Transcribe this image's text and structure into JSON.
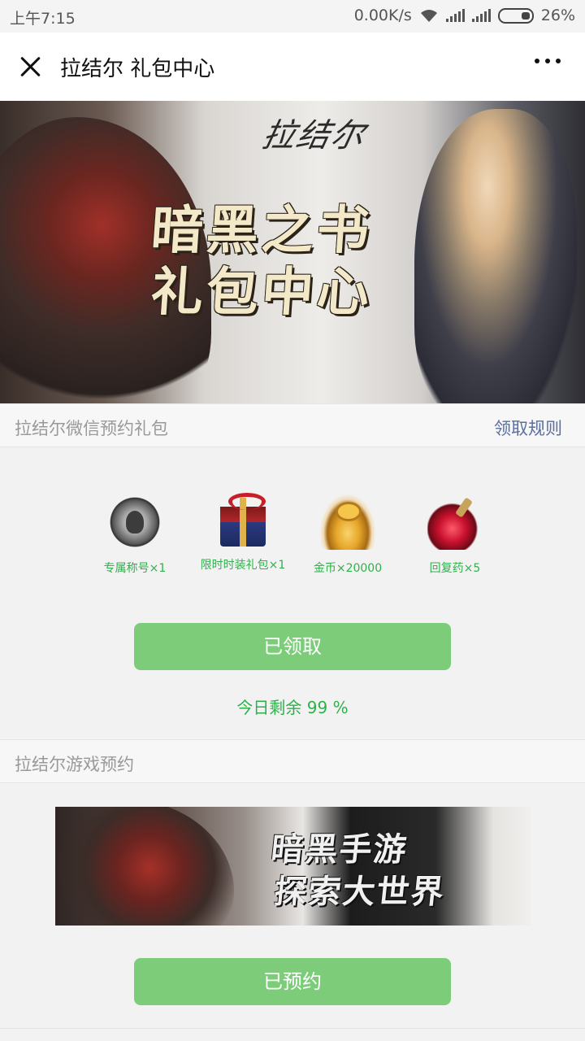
{
  "status_bar": {
    "time": "上午7:15",
    "network_speed": "0.00K/s",
    "battery": "26%",
    "icons": [
      "wifi-icon",
      "signal-icon",
      "signal-icon",
      "battery-icon"
    ]
  },
  "title_bar": {
    "title": "拉结尔 礼包中心",
    "icons": [
      "close-icon",
      "more-icon"
    ]
  },
  "hero": {
    "logo": "拉结尔",
    "headline_line1": "暗黑之书",
    "headline_line2": "礼包中心"
  },
  "gift_section": {
    "title": "拉结尔微信预约礼包",
    "rules_link": "领取规则",
    "items": [
      {
        "label": "专属称号×1",
        "icon": "medal-icon"
      },
      {
        "label": "限时时装礼包×1",
        "icon": "gift-box-icon"
      },
      {
        "label": "金币×20000",
        "icon": "coins-icon"
      },
      {
        "label": "回复药×5",
        "icon": "potion-icon"
      }
    ],
    "claim_button": "已领取",
    "remaining": "今日剩余 99 %"
  },
  "reserve_section": {
    "title": "拉结尔游戏预约",
    "banner_line1": "暗黑手游",
    "banner_line2": "探索大世界",
    "reserve_button": "已预约"
  },
  "colors": {
    "accent_green": "#7ccc7a",
    "text_green": "#2db24a",
    "link_blue": "#5b6e9e"
  }
}
